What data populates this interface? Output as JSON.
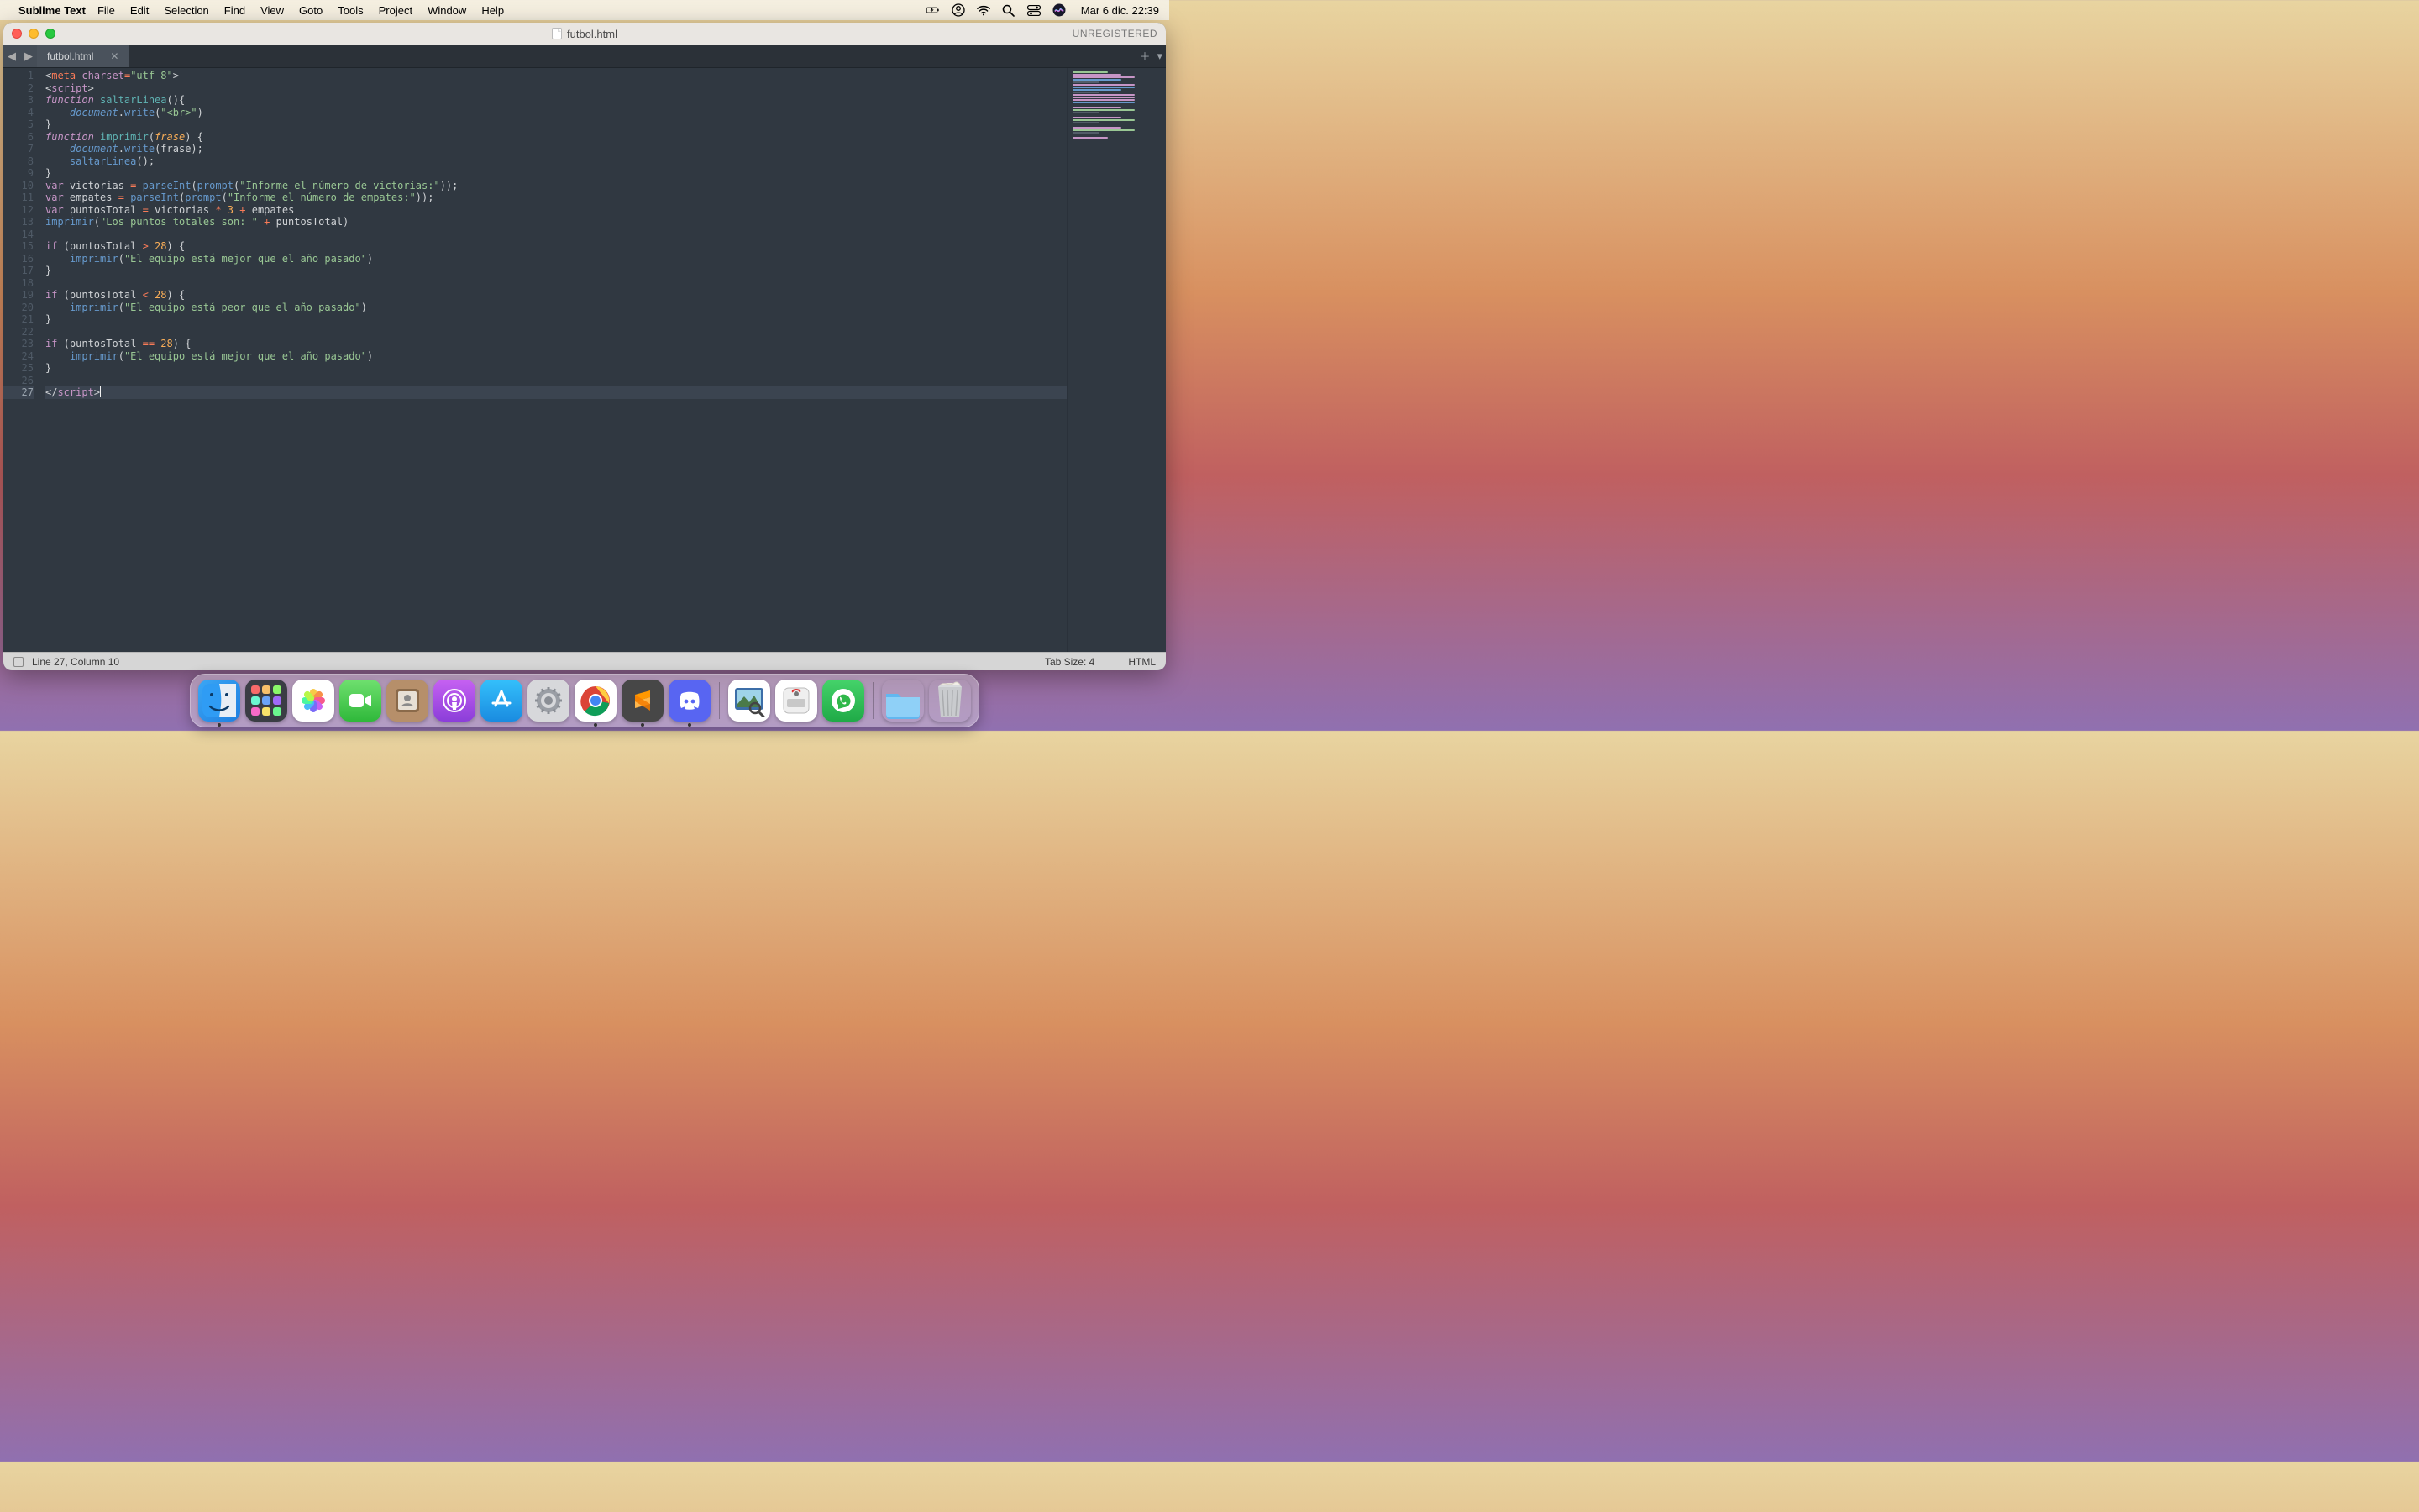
{
  "menubar": {
    "appname": "Sublime Text",
    "items": [
      "File",
      "Edit",
      "Selection",
      "Find",
      "View",
      "Goto",
      "Tools",
      "Project",
      "Window",
      "Help"
    ],
    "clock": "Mar 6 dic.  22:39"
  },
  "window": {
    "title": "futbol.html",
    "unregistered": "UNREGISTERED"
  },
  "tab": {
    "name": "futbol.html"
  },
  "statusbar": {
    "pos": "Line 27, Column 10",
    "tabsize": "Tab Size: 4",
    "lang": "HTML"
  },
  "code": {
    "active_line": 27,
    "lines": [
      [
        [
          "punc",
          "<"
        ],
        [
          "tag",
          "meta"
        ],
        [
          "punc",
          " "
        ],
        [
          "attr",
          "charset"
        ],
        [
          "op",
          "="
        ],
        [
          "str",
          "\"utf-8\""
        ],
        [
          "punc",
          ">"
        ]
      ],
      [
        [
          "punc",
          "<"
        ],
        [
          "script",
          "script"
        ],
        [
          "punc",
          ">"
        ]
      ],
      [
        [
          "kw",
          "function"
        ],
        [
          "punc",
          " "
        ],
        [
          "fn",
          "saltarLinea"
        ],
        [
          "punc",
          "(){"
        ]
      ],
      [
        [
          "punc",
          "    "
        ],
        [
          "obj",
          "document"
        ],
        [
          "punc",
          "."
        ],
        [
          "prop",
          "write"
        ],
        [
          "punc",
          "("
        ],
        [
          "str",
          "\"<br>\""
        ],
        [
          "punc",
          ")"
        ]
      ],
      [
        [
          "punc",
          "}"
        ]
      ],
      [
        [
          "kw",
          "function"
        ],
        [
          "punc",
          " "
        ],
        [
          "fn",
          "imprimir"
        ],
        [
          "punc",
          "("
        ],
        [
          "param",
          "frase"
        ],
        [
          "punc",
          ") {"
        ]
      ],
      [
        [
          "punc",
          "    "
        ],
        [
          "obj",
          "document"
        ],
        [
          "punc",
          "."
        ],
        [
          "prop",
          "write"
        ],
        [
          "punc",
          "("
        ],
        [
          "var",
          "frase"
        ],
        [
          "punc",
          ");"
        ]
      ],
      [
        [
          "punc",
          "    "
        ],
        [
          "fncall",
          "saltarLinea"
        ],
        [
          "punc",
          "();"
        ]
      ],
      [
        [
          "punc",
          "}"
        ]
      ],
      [
        [
          "kw2",
          "var"
        ],
        [
          "punc",
          " victorias "
        ],
        [
          "op",
          "="
        ],
        [
          "punc",
          " "
        ],
        [
          "fncall",
          "parseInt"
        ],
        [
          "punc",
          "("
        ],
        [
          "fncall",
          "prompt"
        ],
        [
          "punc",
          "("
        ],
        [
          "str",
          "\"Informe el número de victorias:\""
        ],
        [
          "punc",
          "));"
        ]
      ],
      [
        [
          "kw2",
          "var"
        ],
        [
          "punc",
          " empates "
        ],
        [
          "op",
          "="
        ],
        [
          "punc",
          " "
        ],
        [
          "fncall",
          "parseInt"
        ],
        [
          "punc",
          "("
        ],
        [
          "fncall",
          "prompt"
        ],
        [
          "punc",
          "("
        ],
        [
          "str",
          "\"Informe el número de empates:\""
        ],
        [
          "punc",
          "));"
        ]
      ],
      [
        [
          "kw2",
          "var"
        ],
        [
          "punc",
          " puntosTotal "
        ],
        [
          "op",
          "="
        ],
        [
          "punc",
          " victorias "
        ],
        [
          "op",
          "*"
        ],
        [
          "punc",
          " "
        ],
        [
          "num",
          "3"
        ],
        [
          "punc",
          " "
        ],
        [
          "op",
          "+"
        ],
        [
          "punc",
          " empates"
        ]
      ],
      [
        [
          "fncall",
          "imprimir"
        ],
        [
          "punc",
          "("
        ],
        [
          "str",
          "\"Los puntos totales son: \""
        ],
        [
          "punc",
          " "
        ],
        [
          "op",
          "+"
        ],
        [
          "punc",
          " puntosTotal)"
        ]
      ],
      [],
      [
        [
          "kw2",
          "if"
        ],
        [
          "punc",
          " (puntosTotal "
        ],
        [
          "op",
          ">"
        ],
        [
          "punc",
          " "
        ],
        [
          "num",
          "28"
        ],
        [
          "punc",
          ") {"
        ]
      ],
      [
        [
          "punc",
          "    "
        ],
        [
          "fncall",
          "imprimir"
        ],
        [
          "punc",
          "("
        ],
        [
          "str",
          "\"El equipo está mejor que el año pasado\""
        ],
        [
          "punc",
          ")"
        ]
      ],
      [
        [
          "punc",
          "}"
        ]
      ],
      [],
      [
        [
          "kw2",
          "if"
        ],
        [
          "punc",
          " (puntosTotal "
        ],
        [
          "op",
          "<"
        ],
        [
          "punc",
          " "
        ],
        [
          "num",
          "28"
        ],
        [
          "punc",
          ") {"
        ]
      ],
      [
        [
          "punc",
          "    "
        ],
        [
          "fncall",
          "imprimir"
        ],
        [
          "punc",
          "("
        ],
        [
          "str",
          "\"El equipo está peor que el año pasado\""
        ],
        [
          "punc",
          ")"
        ]
      ],
      [
        [
          "punc",
          "}"
        ]
      ],
      [],
      [
        [
          "kw2",
          "if"
        ],
        [
          "punc",
          " (puntosTotal "
        ],
        [
          "op",
          "=="
        ],
        [
          "punc",
          " "
        ],
        [
          "num",
          "28"
        ],
        [
          "punc",
          ") {"
        ]
      ],
      [
        [
          "punc",
          "    "
        ],
        [
          "fncall",
          "imprimir"
        ],
        [
          "punc",
          "("
        ],
        [
          "str",
          "\"El equipo está mejor que el año pasado\""
        ],
        [
          "punc",
          ")"
        ]
      ],
      [
        [
          "punc",
          "}"
        ]
      ],
      [],
      [
        [
          "punc",
          "</"
        ],
        [
          "script",
          "script"
        ],
        [
          "punc",
          ">"
        ]
      ]
    ]
  },
  "dock": {
    "items": [
      {
        "id": "finder",
        "label": "Finder",
        "running": true
      },
      {
        "id": "launchpad",
        "label": "Launchpad"
      },
      {
        "id": "photos",
        "label": "Photos"
      },
      {
        "id": "facetime",
        "label": "FaceTime"
      },
      {
        "id": "contacts",
        "label": "Contacts"
      },
      {
        "id": "podcasts",
        "label": "Podcasts"
      },
      {
        "id": "appstore",
        "label": "App Store"
      },
      {
        "id": "settings",
        "label": "System Preferences"
      },
      {
        "id": "chrome",
        "label": "Google Chrome",
        "running": true
      },
      {
        "id": "sublime",
        "label": "Sublime Text",
        "running": true
      },
      {
        "id": "discord",
        "label": "Discord",
        "running": true
      }
    ],
    "items2": [
      {
        "id": "preview",
        "label": "Preview"
      },
      {
        "id": "diskutil",
        "label": "Disk Utility"
      },
      {
        "id": "whatsapp",
        "label": "WhatsApp"
      }
    ],
    "items3": [
      {
        "id": "downloads",
        "label": "Downloads"
      },
      {
        "id": "trash",
        "label": "Trash"
      }
    ]
  }
}
